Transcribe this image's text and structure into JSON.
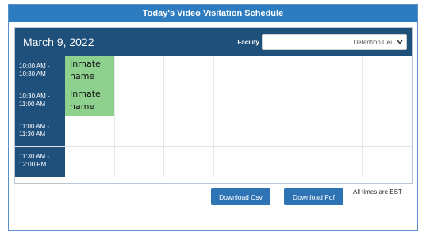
{
  "window": {
    "title": "Today's Video Visitation Schedule"
  },
  "header": {
    "date": "March 9, 2022",
    "facility_label": "Facility",
    "facility_value": "Detention Cei"
  },
  "schedule": {
    "rows": [
      {
        "time": "10:00 AM -\n10:30 AM",
        "cells": [
          "Inmate\nname",
          "",
          "",
          "",
          "",
          "",
          ""
        ]
      },
      {
        "time": "10:30 AM -\n11:00 AM",
        "cells": [
          "Inmate\nname",
          "",
          "",
          "",
          "",
          "",
          ""
        ]
      },
      {
        "time": "11:00 AM -\n11:30 AM",
        "cells": [
          "",
          "",
          "",
          "",
          "",
          "",
          ""
        ]
      },
      {
        "time": "11:30 AM -\n12:00 PM",
        "cells": [
          "",
          "",
          "",
          "",
          "",
          "",
          ""
        ]
      }
    ]
  },
  "actions": {
    "download_csv": "Download Csv",
    "download_pdf": "Download Pdf",
    "times_note": "All times are EST"
  },
  "colors": {
    "title_bar": "#2e7cc0",
    "header_bar": "#1f4f7b",
    "booked": "#8ed18e",
    "button": "#2e74b5"
  }
}
